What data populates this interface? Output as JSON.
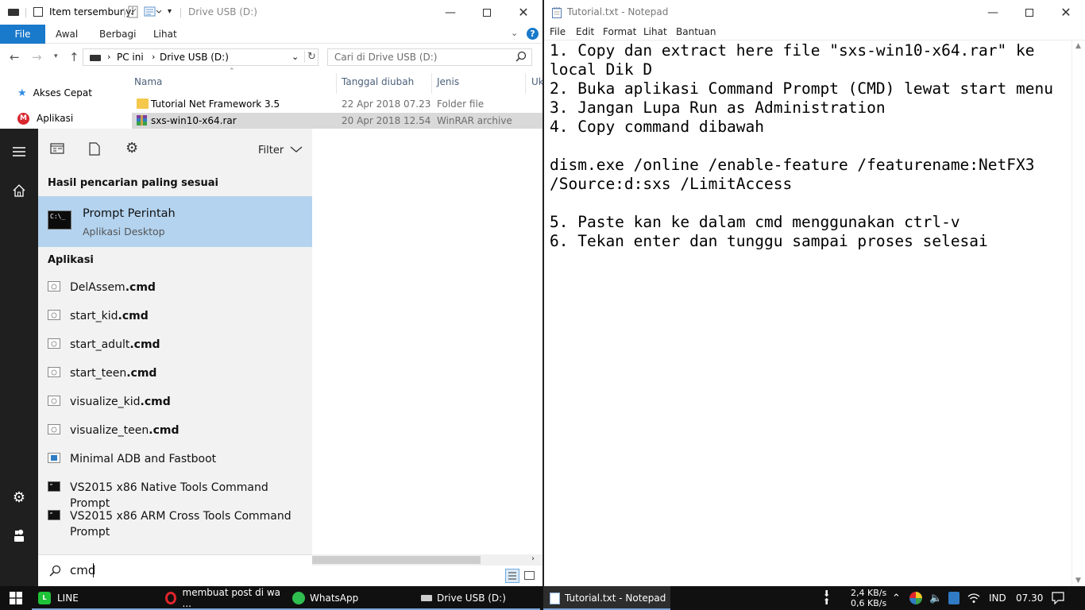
{
  "explorer": {
    "quick_access_checkbox_label": "Item tersembunyi",
    "title": "Drive USB (D:)",
    "ribbon_tabs": [
      "File",
      "Awal",
      "Berbagi",
      "Lihat"
    ],
    "breadcrumb": [
      "PC ini",
      "Drive USB (D:)"
    ],
    "search_placeholder": "Cari di Drive USB (D:)",
    "nav_items": [
      "Akses Cepat",
      "Aplikasi"
    ],
    "columns": [
      "Nama",
      "Tanggal diubah",
      "Jenis",
      "Uk"
    ],
    "files": [
      {
        "name": "Tutorial Net Framework 3.5",
        "date": "22 Apr 2018 07.23",
        "type": "Folder file"
      },
      {
        "name": "sxs-win10-x64.rar",
        "date": "20 Apr 2018 12.54",
        "type": "WinRAR archive"
      }
    ]
  },
  "start_menu": {
    "filter_label": "Filter",
    "best_match_header": "Hasil pencarian paling sesuai",
    "best_match": {
      "title": "Prompt Perintah",
      "subtitle": "Aplikasi Desktop"
    },
    "apps_header": "Aplikasi",
    "apps": [
      {
        "name": "DelAssem",
        "ext": ".cmd"
      },
      {
        "name": "start_kid",
        "ext": ".cmd"
      },
      {
        "name": "start_adult",
        "ext": ".cmd"
      },
      {
        "name": "start_teen",
        "ext": ".cmd"
      },
      {
        "name": "visualize_kid",
        "ext": ".cmd"
      },
      {
        "name": "visualize_teen",
        "ext": ".cmd"
      },
      {
        "name": "Minimal ADB and Fastboot",
        "ext": ""
      },
      {
        "name": "VS2015 x86 Native Tools Command Prompt",
        "ext": ""
      },
      {
        "name": "VS2015 x86 ARM Cross Tools Command Prompt",
        "ext": ""
      }
    ],
    "search_value": "cmd"
  },
  "notepad": {
    "title": "Tutorial.txt - Notepad",
    "menu": [
      "File",
      "Edit",
      "Format",
      "Lihat",
      "Bantuan"
    ],
    "content": "1. Copy dan extract here file \"sxs-win10-x64.rar\" ke\nlocal Dik D\n2. Buka aplikasi Command Prompt (CMD) lewat start menu\n3. Jangan Lupa Run as Administration\n4. Copy command dibawah\n\ndism.exe /online /enable-feature /featurename:NetFX3\n/Source:d:sxs /LimitAccess\n\n5. Paste kan ke dalam cmd menggunakan ctrl-v\n6. Tekan enter dan tunggu sampai proses selesai"
  },
  "taskbar": {
    "items": [
      "LINE",
      "membuat post di wa ...",
      "WhatsApp",
      "Drive USB (D:)",
      "Tutorial.txt - Notepad"
    ],
    "net_up": "2,4 KB/s",
    "net_down": "0,6 KB/s",
    "language": "IND",
    "time": "07.30"
  },
  "colors": {
    "accent": "#1979ca",
    "selection": "#b3d3ef",
    "file_selected": "#d9d9d9",
    "taskbar": "#101010"
  }
}
